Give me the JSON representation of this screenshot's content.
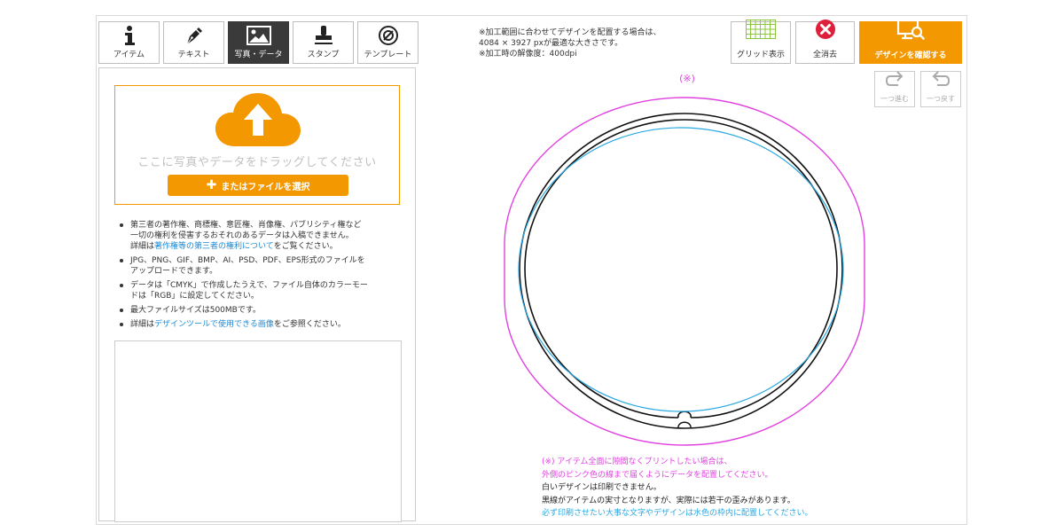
{
  "tabs": [
    {
      "label": "アイテム",
      "icon": "info-icon"
    },
    {
      "label": "テキスト",
      "icon": "pen-icon"
    },
    {
      "label": "写真・データ",
      "icon": "image-icon"
    },
    {
      "label": "スタンプ",
      "icon": "stamp-icon"
    },
    {
      "label": "テンプレート",
      "icon": "template-icon"
    }
  ],
  "upload": {
    "drag_text": "ここに写真やデータをドラッグしてください",
    "select_label": "またはファイルを選択"
  },
  "notes": {
    "n1_a": "第三者の著作権、商標権、意匠権、肖像権、パブリシティ権など",
    "n1_b": "一切の権利を侵害するおそれのあるデータは入稿できません。",
    "n1_c_pre": "詳細は",
    "n1_c_link": "著作権等の第三者の権利について",
    "n1_c_post": "をご覧ください。",
    "n2_a": "JPG、PNG、GIF、BMP、AI、PSD、PDF、EPS形式のファイルを",
    "n2_b": "アップロードできます。",
    "n3_a": "データは「CMYK」で作成したうえで、ファイル自体のカラーモー",
    "n3_b": "ドは「RGB」に設定してください。",
    "n4": "最大ファイルサイズは500MBです。",
    "n5_pre": "詳細は",
    "n5_link": "デザインツールで使用できる画像",
    "n5_post": "をご参照ください。"
  },
  "spec": {
    "line1": "※加工範囲に合わせてデザインを配置する場合は、",
    "line2": "4084 × 3927 pxが最適な大きさです。",
    "line3": "※加工時の解像度：400dpi"
  },
  "toolbar": {
    "grid_label": "グリッド表示",
    "clear_label": "全消去",
    "confirm_label": "デザインを確認する",
    "redo_label": "一つ進む",
    "undo_label": "一つ戻す"
  },
  "canvas": {
    "mark": "(※)"
  },
  "bottom_notes": {
    "pink1": "(※) アイテム全面に隙間なくプリントしたい場合は、",
    "pink2": "外側のピンク色の線まで届くようにデータを配置してください。",
    "dark1": "白いデザインは印刷できません。",
    "dark2": "黒線がアイテムの実寸となりますが、実際には若干の歪みがあります。",
    "blue1": "必ず印刷させたい大事な文字やデザインは水色の枠内に配置してください。"
  },
  "colors": {
    "accent": "#f39800",
    "pink_line": "#e040e0",
    "blue_line": "#29a8e0",
    "clear_red": "#e0203a",
    "grid_green": "#8cc63f",
    "link": "#1a8ad6"
  }
}
